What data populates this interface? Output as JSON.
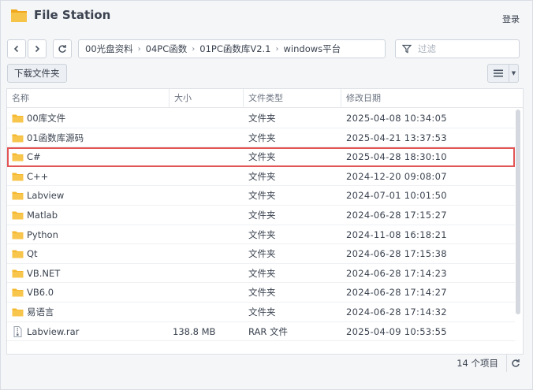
{
  "app": {
    "title": "File Station",
    "login_label": "登录"
  },
  "toolbar": {
    "back_icon": "chevron-left-icon",
    "forward_icon": "chevron-right-icon",
    "refresh_icon": "refresh-icon",
    "breadcrumb": [
      "00光盘资料",
      "04PC函数",
      "01PC函数库V2.1",
      "windows平台"
    ],
    "filter_placeholder": "过滤",
    "download_label": "下载文件夹",
    "view_icon": "list-view-icon"
  },
  "table": {
    "columns": [
      "名称",
      "大小",
      "文件类型",
      "修改日期"
    ],
    "rows": [
      {
        "name": "00库文件",
        "size": "",
        "type": "文件夹",
        "date": "2025-04-08 10:34:05",
        "icon": "folder-icon"
      },
      {
        "name": "01函数库源码",
        "size": "",
        "type": "文件夹",
        "date": "2025-04-21 13:37:53",
        "icon": "folder-icon"
      },
      {
        "name": "C#",
        "size": "",
        "type": "文件夹",
        "date": "2025-04-28 18:30:10",
        "icon": "folder-icon",
        "selected": true
      },
      {
        "name": "C++",
        "size": "",
        "type": "文件夹",
        "date": "2024-12-20 09:08:07",
        "icon": "folder-icon"
      },
      {
        "name": "Labview",
        "size": "",
        "type": "文件夹",
        "date": "2024-07-01 10:01:50",
        "icon": "folder-icon"
      },
      {
        "name": "Matlab",
        "size": "",
        "type": "文件夹",
        "date": "2024-06-28 17:15:27",
        "icon": "folder-icon"
      },
      {
        "name": "Python",
        "size": "",
        "type": "文件夹",
        "date": "2024-11-08 16:18:21",
        "icon": "folder-icon"
      },
      {
        "name": "Qt",
        "size": "",
        "type": "文件夹",
        "date": "2024-06-28 17:15:38",
        "icon": "folder-icon"
      },
      {
        "name": "VB.NET",
        "size": "",
        "type": "文件夹",
        "date": "2024-06-28 17:14:23",
        "icon": "folder-icon"
      },
      {
        "name": "VB6.0",
        "size": "",
        "type": "文件夹",
        "date": "2024-06-28 17:14:27",
        "icon": "folder-icon"
      },
      {
        "name": "易语言",
        "size": "",
        "type": "文件夹",
        "date": "2024-06-28 17:14:32",
        "icon": "folder-icon"
      },
      {
        "name": "Labview.rar",
        "size": "138.8 MB",
        "type": "RAR 文件",
        "date": "2025-04-09 10:53:55",
        "icon": "archive-file-icon"
      }
    ]
  },
  "status": {
    "item_count": "14 个项目",
    "refresh_icon": "refresh-icon"
  },
  "colors": {
    "folder": "#f5b82e",
    "selection_outline": "#e35454",
    "accent": "#3b4350"
  }
}
